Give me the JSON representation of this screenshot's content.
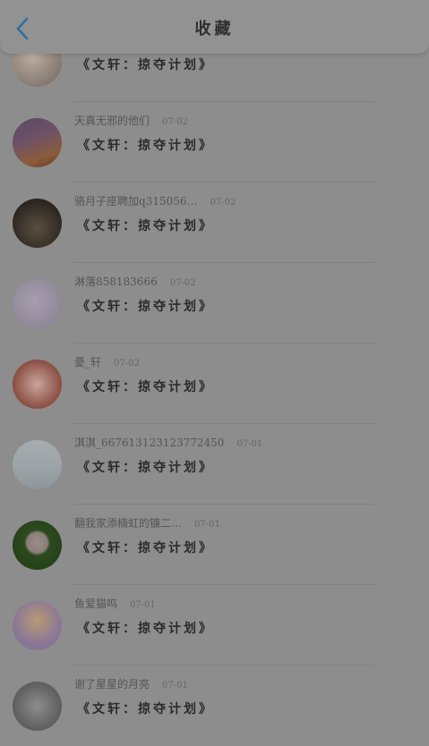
{
  "header": {
    "title": "收藏",
    "back_icon": "chevron-left-icon",
    "back_color": "#2f6fa3"
  },
  "message_text": "《文轩：掠夺计划》",
  "items": [
    {
      "name": "",
      "date": "",
      "msg": "《文轩：掠夺计划》"
    },
    {
      "name": "天真无邪的他们",
      "date": "07-02",
      "msg": "《文轩：掠夺计划》"
    },
    {
      "name": "骆月子座聘加q315056…",
      "date": "07-02",
      "msg": "《文轩：掠夺计划》"
    },
    {
      "name": "淋落858183666",
      "date": "07-02",
      "msg": "《文轩：掠夺计划》"
    },
    {
      "name": "憂_轩",
      "date": "07-02",
      "msg": "《文轩：掠夺计划》"
    },
    {
      "name": "淇淇_667613123123772450",
      "date": "07-01",
      "msg": "《文轩：掠夺计划》"
    },
    {
      "name": "翻我家添楠虹的镰二…",
      "date": "07-01",
      "msg": "《文轩：掠夺计划》"
    },
    {
      "name": "鱼爱猫鸣",
      "date": "07-01",
      "msg": "《文轩：掠夺计划》"
    },
    {
      "name": "谢了星星的月亮",
      "date": "07-01",
      "msg": "《文轩：掠夺计划》"
    }
  ]
}
